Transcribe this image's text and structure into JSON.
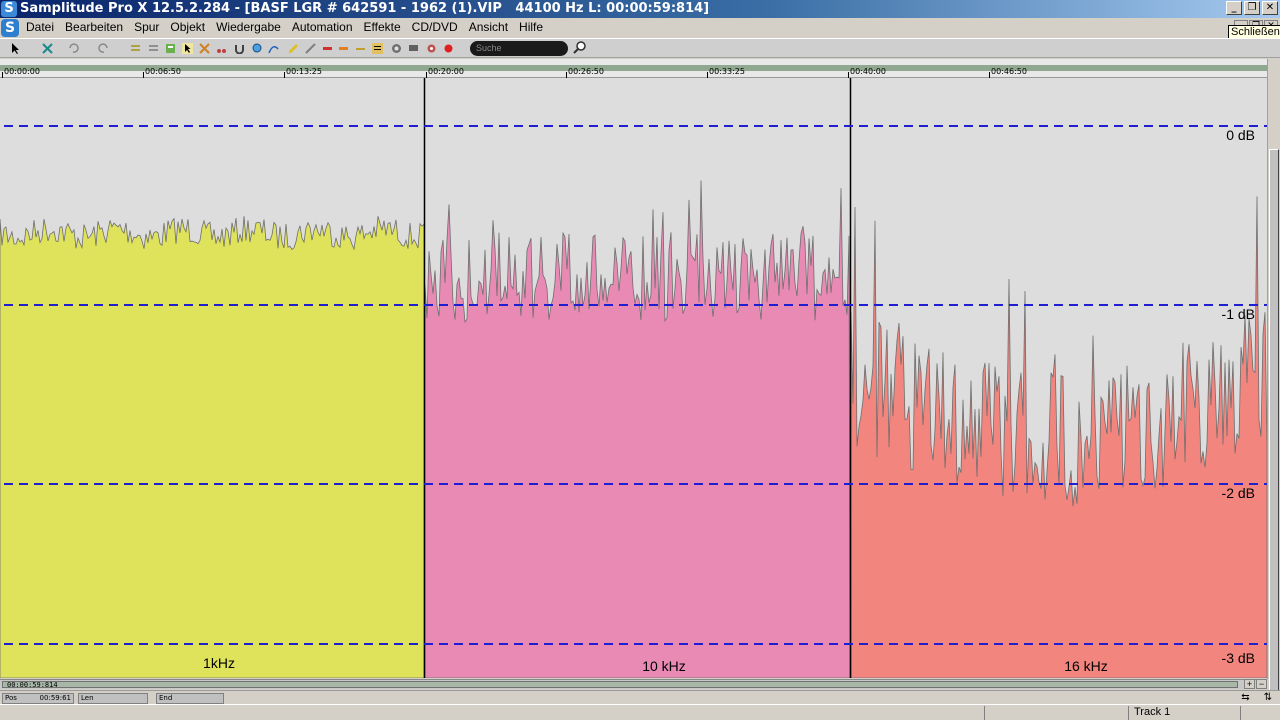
{
  "window": {
    "title": "Samplitude Pro X 12.5.2.284 - [BASF LGR # 642591 - 1962 (1).VIP   44100 Hz L: 00:00:59:814]",
    "logo": "S",
    "controls": [
      "_",
      "❐",
      "✕"
    ],
    "tooltip": "Schließen"
  },
  "menu": {
    "items": [
      "Datei",
      "Bearbeiten",
      "Spur",
      "Objekt",
      "Wiedergabe",
      "Automation",
      "Effekte",
      "CD/DVD",
      "Ansicht",
      "Hilfe"
    ]
  },
  "toolbar": {
    "search_placeholder": "Suche",
    "icons": [
      "pointer-icon",
      "crossfade-icon",
      "undo-icon",
      "redo-icon",
      "list-icon",
      "range-icon",
      "object-icon",
      "cut-icon",
      "scissors-icon",
      "magnet-icon",
      "zoom-icon",
      "curve-icon",
      "pencil-icon",
      "pen-icon",
      "marker-icon",
      "record-icon"
    ]
  },
  "ruler": {
    "labels": [
      "00:00:00",
      "00:06:50",
      "00:13:25",
      "00:20:00",
      "00:26:50",
      "00:33:25",
      "00:40:00",
      "00:46:50"
    ]
  },
  "track": {
    "db_labels": [
      "0 dB",
      "-1 dB",
      "-2 dB",
      "-3 dB"
    ],
    "db_values": [
      0,
      -1,
      -2,
      -3
    ],
    "segments": [
      {
        "label": "1kHz",
        "color": "#dfe35c"
      },
      {
        "label": "10 kHz",
        "color": "#e88ab4"
      },
      {
        "label": "16 kHz",
        "color": "#f2857e"
      }
    ],
    "grid_color": "#1f1fd0",
    "background": "#dddddd"
  },
  "scroll": {
    "position_text": "00:00:59:814"
  },
  "position": {
    "pos_label": "Pos",
    "pos_value": "00:59:61",
    "len_label": "Len",
    "end_label": "End"
  },
  "status": {
    "track_label": "Track 1"
  }
}
